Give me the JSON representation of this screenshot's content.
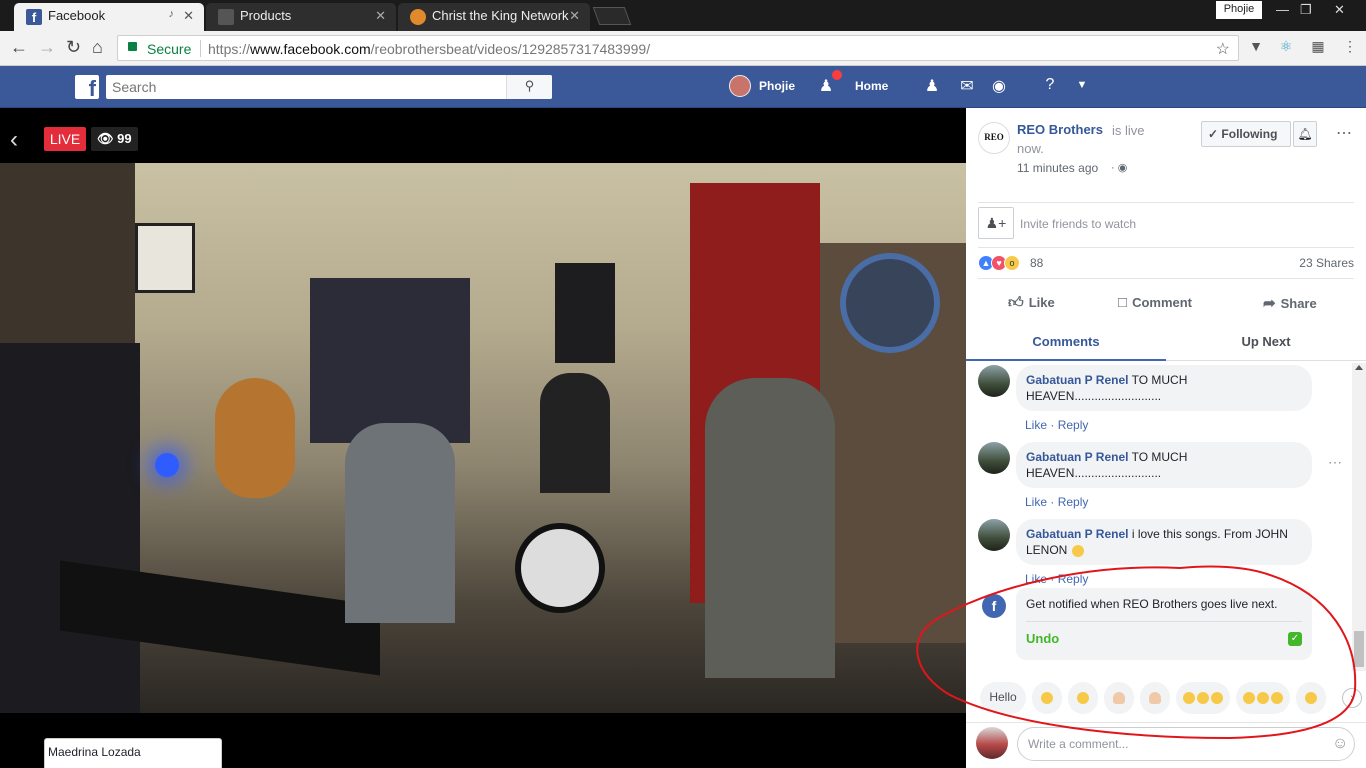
{
  "browser": {
    "tabs": [
      {
        "title": "Facebook",
        "active": true
      },
      {
        "title": "Products",
        "active": false
      },
      {
        "title": "Christ the King Network",
        "active": false
      }
    ],
    "profile_name": "Phojie",
    "address": {
      "secure_label": "Secure",
      "scheme": "https://",
      "host": "www.facebook.com",
      "path": "/reobrothersbeat/videos/1292857317483999/"
    }
  },
  "fb_header": {
    "search_placeholder": "Search",
    "user_name": "Phojie",
    "home_label": "Home",
    "colors": {
      "bar": "#3b5998",
      "notification": "#fa3e3e"
    }
  },
  "video": {
    "live_label": "LIVE",
    "viewer_count": "99",
    "chat_tab_name": "Maedrina Lozada"
  },
  "panel": {
    "page_logo_text": "REO",
    "page_name": "REO Brothers",
    "live_text": "is live",
    "live_text_2": "now.",
    "time_ago": "11 minutes ago",
    "following_label": "Following",
    "invite_text": "Invite friends to watch",
    "reaction_count": "88",
    "shares_text": "23 Shares",
    "actions": {
      "like": "Like",
      "comment": "Comment",
      "share": "Share"
    },
    "tabs": {
      "comments": "Comments",
      "up_next": "Up Next"
    },
    "comments": [
      {
        "author": "Gabatuan P Renel",
        "text": "TO MUCH HEAVEN..........................",
        "like": "Like",
        "reply": "Reply"
      },
      {
        "author": "Gabatuan P Renel",
        "text": "TO MUCH HEAVEN..........................",
        "like": "Like",
        "reply": "Reply"
      },
      {
        "author": "Gabatuan P Renel",
        "text": "i love this songs. From JOHN LENON",
        "like": "Like",
        "reply": "Reply"
      }
    ],
    "notify": {
      "text": "Get notified when REO Brothers goes live next.",
      "undo_label": "Undo"
    },
    "quick_replies": {
      "hello": "Hello"
    },
    "composer_placeholder": "Write a comment...",
    "annotation_color": "#e0161b"
  }
}
